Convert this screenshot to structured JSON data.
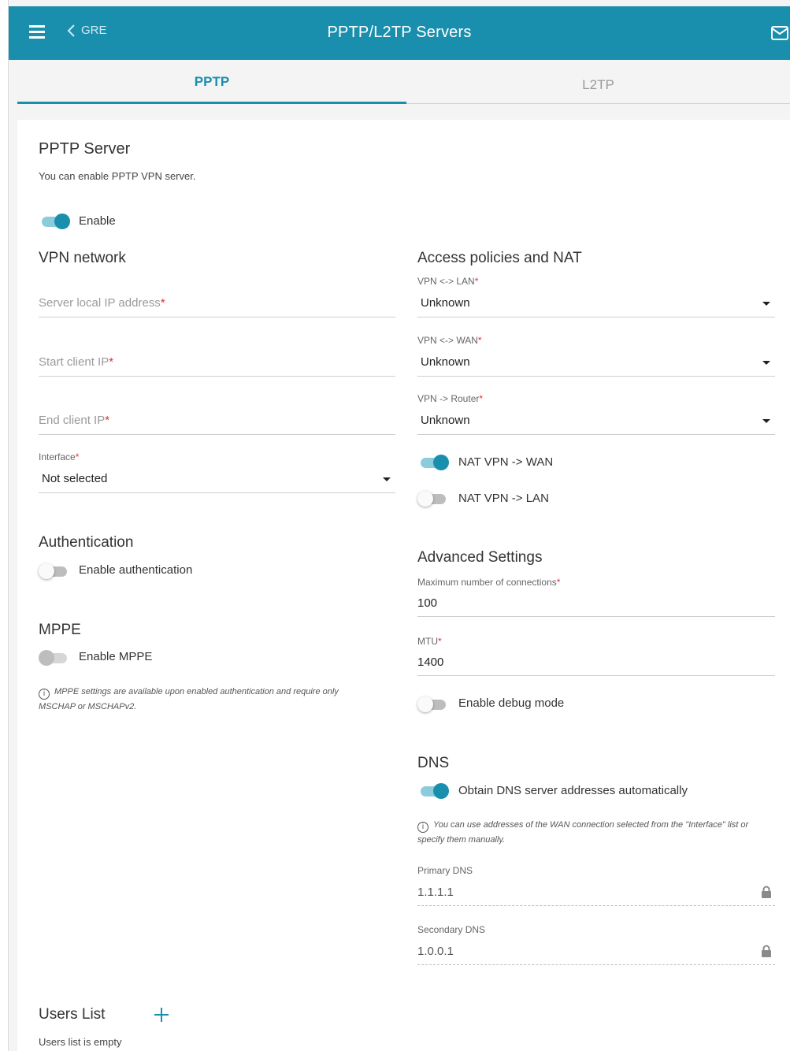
{
  "header": {
    "back_label": "GRE",
    "title": "PPTP/L2TP Servers"
  },
  "tabs": [
    {
      "label": "PPTP",
      "active": true
    },
    {
      "label": "L2TP",
      "active": false
    }
  ],
  "pptp_server": {
    "title": "PPTP Server",
    "description": "You can enable PPTP VPN server.",
    "enable_label": "Enable",
    "enabled": true
  },
  "vpn_network": {
    "title": "VPN network",
    "server_ip_placeholder": "Server local IP address",
    "start_ip_placeholder": "Start client IP",
    "end_ip_placeholder": "End client IP",
    "interface_label": "Interface",
    "interface_value": "Not selected"
  },
  "authentication": {
    "title": "Authentication",
    "enable_label": "Enable authentication",
    "enabled": false
  },
  "mppe": {
    "title": "MPPE",
    "enable_label": "Enable MPPE",
    "enabled": false,
    "note": "MPPE settings are available upon enabled authentication and require only MSCHAP or MSCHAPv2."
  },
  "access": {
    "title": "Access policies and NAT",
    "vpn_lan_label": "VPN <-> LAN",
    "vpn_lan_value": "Unknown",
    "vpn_wan_label": "VPN <-> WAN",
    "vpn_wan_value": "Unknown",
    "vpn_router_label": "VPN -> Router",
    "vpn_router_value": "Unknown",
    "nat_wan_label": "NAT VPN -> WAN",
    "nat_wan_enabled": true,
    "nat_lan_label": "NAT VPN -> LAN",
    "nat_lan_enabled": false
  },
  "advanced": {
    "title": "Advanced Settings",
    "max_conn_label": "Maximum number of connections",
    "max_conn_value": "100",
    "mtu_label": "MTU",
    "mtu_value": "1400",
    "debug_label": "Enable debug mode",
    "debug_enabled": false
  },
  "dns": {
    "title": "DNS",
    "auto_label": "Obtain DNS server addresses automatically",
    "auto_enabled": true,
    "note": "You can use addresses of the WAN connection selected from the \"Interface\" list or specify them manually.",
    "primary_label": "Primary DNS",
    "primary_value": "1.1.1.1",
    "secondary_label": "Secondary DNS",
    "secondary_value": "1.0.0.1"
  },
  "users": {
    "title": "Users List",
    "empty_text": "Users list is empty"
  },
  "colors": {
    "accent": "#1a8fad",
    "required": "#e0303a"
  }
}
